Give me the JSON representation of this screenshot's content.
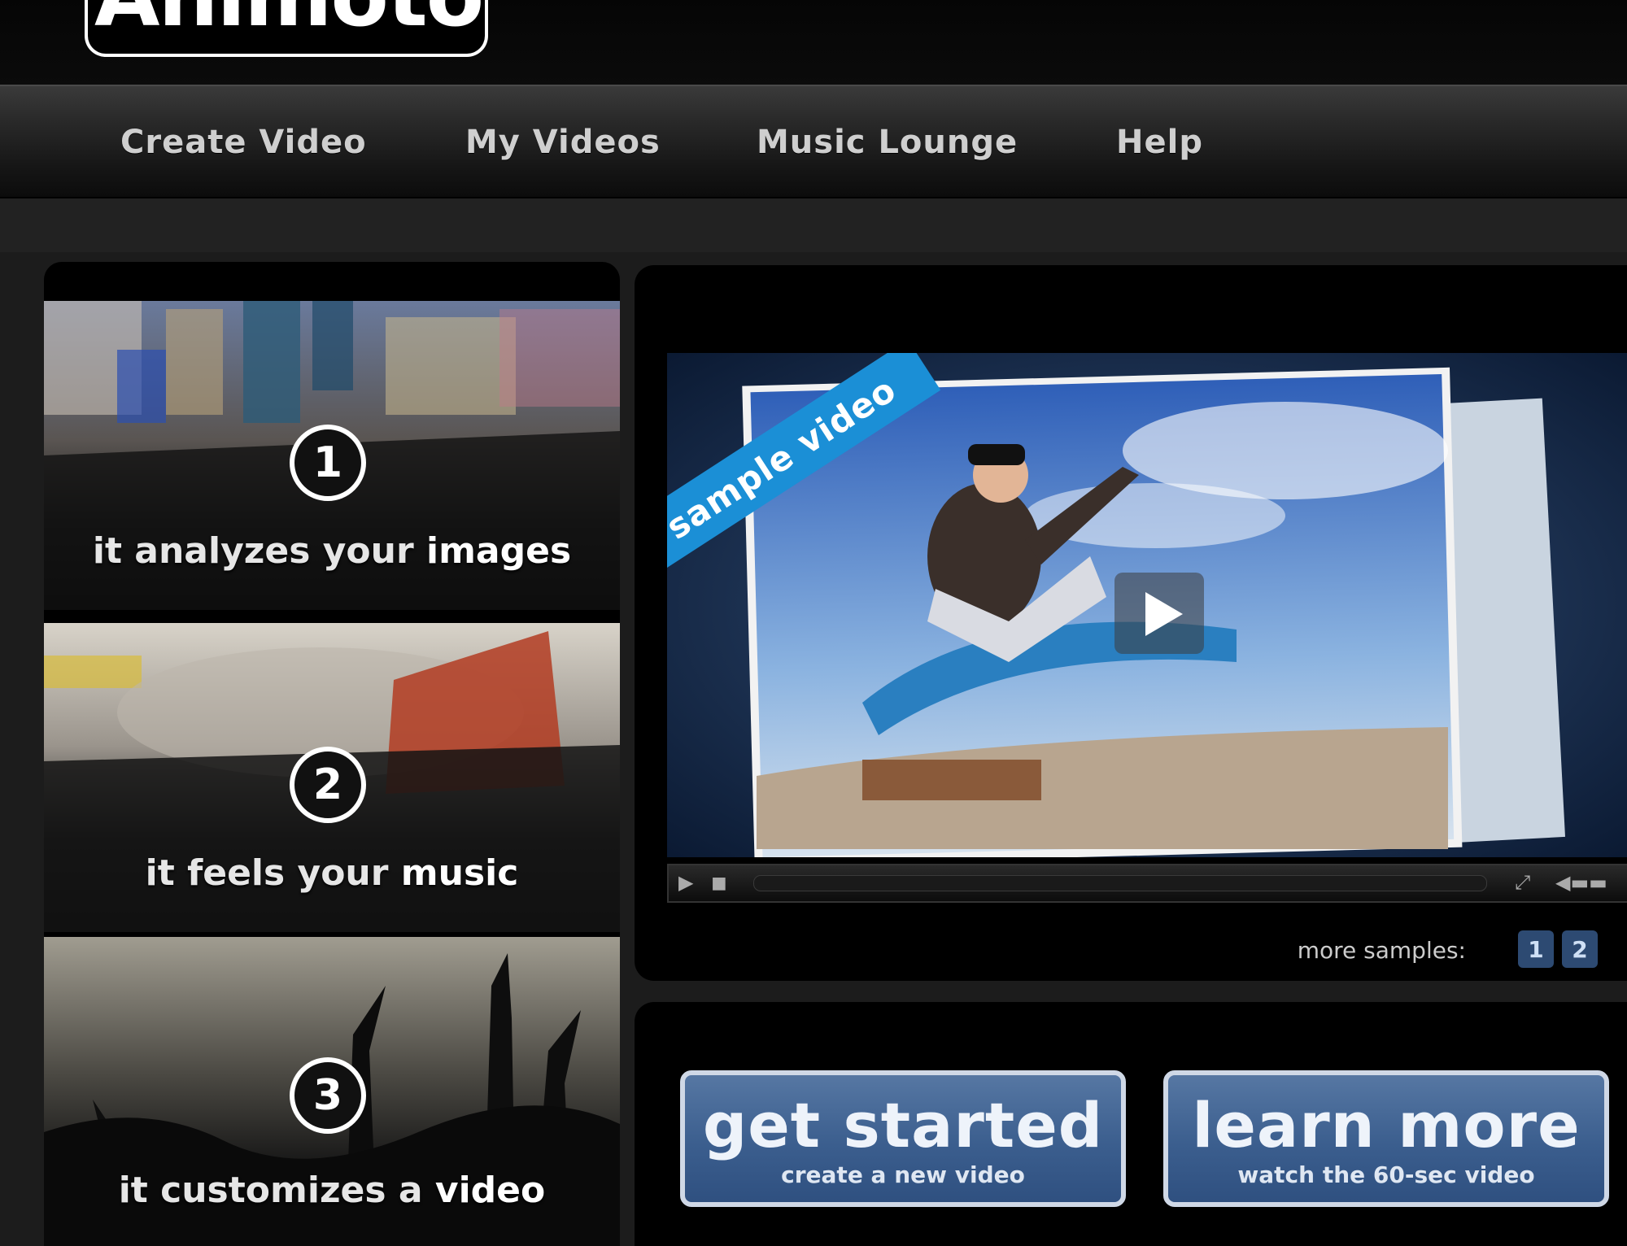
{
  "header": {
    "logo_text": "Animoto"
  },
  "nav": {
    "items": [
      {
        "label": "Create Video"
      },
      {
        "label": "My Videos"
      },
      {
        "label": "Music Lounge"
      },
      {
        "label": "Help"
      }
    ]
  },
  "steps": [
    {
      "number": "1",
      "caption_prefix": "it analyzes your ",
      "caption_bold": "images"
    },
    {
      "number": "2",
      "caption_prefix": "it feels your ",
      "caption_bold": "music"
    },
    {
      "number": "3",
      "caption_prefix": "it customizes a ",
      "caption_bold": "video"
    }
  ],
  "video": {
    "ribbon": "sample video",
    "more_samples_label": "more samples:",
    "samples": [
      "1",
      "2"
    ]
  },
  "actions": {
    "get_started": {
      "title": "get started",
      "subtitle": "create a new video"
    },
    "learn_more": {
      "title": "learn more",
      "subtitle": "watch the 60-sec video"
    }
  },
  "colors": {
    "ribbon_blue": "#1b8fd6",
    "button_blue": "#3b5e8e",
    "background": "#1c1c1c"
  }
}
